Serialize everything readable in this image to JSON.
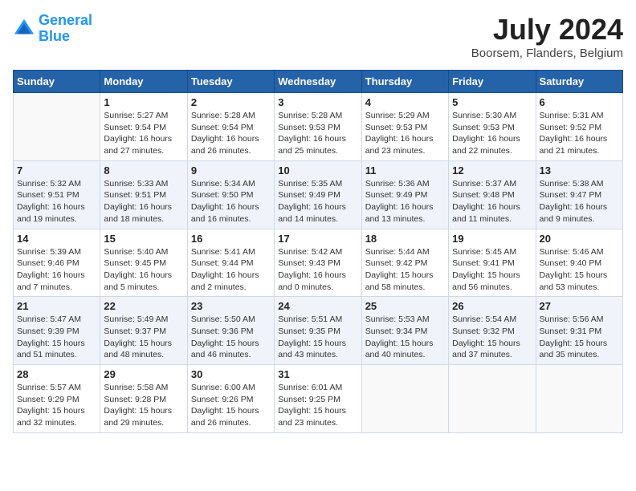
{
  "header": {
    "logo_line1": "General",
    "logo_line2": "Blue",
    "month_year": "July 2024",
    "location": "Boorsem, Flanders, Belgium"
  },
  "days_of_week": [
    "Sunday",
    "Monday",
    "Tuesday",
    "Wednesday",
    "Thursday",
    "Friday",
    "Saturday"
  ],
  "weeks": [
    [
      {
        "day": "",
        "content": ""
      },
      {
        "day": "1",
        "content": "Sunrise: 5:27 AM\nSunset: 9:54 PM\nDaylight: 16 hours and 27 minutes."
      },
      {
        "day": "2",
        "content": "Sunrise: 5:28 AM\nSunset: 9:54 PM\nDaylight: 16 hours and 26 minutes."
      },
      {
        "day": "3",
        "content": "Sunrise: 5:28 AM\nSunset: 9:53 PM\nDaylight: 16 hours and 25 minutes."
      },
      {
        "day": "4",
        "content": "Sunrise: 5:29 AM\nSunset: 9:53 PM\nDaylight: 16 hours and 23 minutes."
      },
      {
        "day": "5",
        "content": "Sunrise: 5:30 AM\nSunset: 9:53 PM\nDaylight: 16 hours and 22 minutes."
      },
      {
        "day": "6",
        "content": "Sunrise: 5:31 AM\nSunset: 9:52 PM\nDaylight: 16 hours and 21 minutes."
      }
    ],
    [
      {
        "day": "7",
        "content": "Sunrise: 5:32 AM\nSunset: 9:51 PM\nDaylight: 16 hours and 19 minutes."
      },
      {
        "day": "8",
        "content": "Sunrise: 5:33 AM\nSunset: 9:51 PM\nDaylight: 16 hours and 18 minutes."
      },
      {
        "day": "9",
        "content": "Sunrise: 5:34 AM\nSunset: 9:50 PM\nDaylight: 16 hours and 16 minutes."
      },
      {
        "day": "10",
        "content": "Sunrise: 5:35 AM\nSunset: 9:49 PM\nDaylight: 16 hours and 14 minutes."
      },
      {
        "day": "11",
        "content": "Sunrise: 5:36 AM\nSunset: 9:49 PM\nDaylight: 16 hours and 13 minutes."
      },
      {
        "day": "12",
        "content": "Sunrise: 5:37 AM\nSunset: 9:48 PM\nDaylight: 16 hours and 11 minutes."
      },
      {
        "day": "13",
        "content": "Sunrise: 5:38 AM\nSunset: 9:47 PM\nDaylight: 16 hours and 9 minutes."
      }
    ],
    [
      {
        "day": "14",
        "content": "Sunrise: 5:39 AM\nSunset: 9:46 PM\nDaylight: 16 hours and 7 minutes."
      },
      {
        "day": "15",
        "content": "Sunrise: 5:40 AM\nSunset: 9:45 PM\nDaylight: 16 hours and 5 minutes."
      },
      {
        "day": "16",
        "content": "Sunrise: 5:41 AM\nSunset: 9:44 PM\nDaylight: 16 hours and 2 minutes."
      },
      {
        "day": "17",
        "content": "Sunrise: 5:42 AM\nSunset: 9:43 PM\nDaylight: 16 hours and 0 minutes."
      },
      {
        "day": "18",
        "content": "Sunrise: 5:44 AM\nSunset: 9:42 PM\nDaylight: 15 hours and 58 minutes."
      },
      {
        "day": "19",
        "content": "Sunrise: 5:45 AM\nSunset: 9:41 PM\nDaylight: 15 hours and 56 minutes."
      },
      {
        "day": "20",
        "content": "Sunrise: 5:46 AM\nSunset: 9:40 PM\nDaylight: 15 hours and 53 minutes."
      }
    ],
    [
      {
        "day": "21",
        "content": "Sunrise: 5:47 AM\nSunset: 9:39 PM\nDaylight: 15 hours and 51 minutes."
      },
      {
        "day": "22",
        "content": "Sunrise: 5:49 AM\nSunset: 9:37 PM\nDaylight: 15 hours and 48 minutes."
      },
      {
        "day": "23",
        "content": "Sunrise: 5:50 AM\nSunset: 9:36 PM\nDaylight: 15 hours and 46 minutes."
      },
      {
        "day": "24",
        "content": "Sunrise: 5:51 AM\nSunset: 9:35 PM\nDaylight: 15 hours and 43 minutes."
      },
      {
        "day": "25",
        "content": "Sunrise: 5:53 AM\nSunset: 9:34 PM\nDaylight: 15 hours and 40 minutes."
      },
      {
        "day": "26",
        "content": "Sunrise: 5:54 AM\nSunset: 9:32 PM\nDaylight: 15 hours and 37 minutes."
      },
      {
        "day": "27",
        "content": "Sunrise: 5:56 AM\nSunset: 9:31 PM\nDaylight: 15 hours and 35 minutes."
      }
    ],
    [
      {
        "day": "28",
        "content": "Sunrise: 5:57 AM\nSunset: 9:29 PM\nDaylight: 15 hours and 32 minutes."
      },
      {
        "day": "29",
        "content": "Sunrise: 5:58 AM\nSunset: 9:28 PM\nDaylight: 15 hours and 29 minutes."
      },
      {
        "day": "30",
        "content": "Sunrise: 6:00 AM\nSunset: 9:26 PM\nDaylight: 15 hours and 26 minutes."
      },
      {
        "day": "31",
        "content": "Sunrise: 6:01 AM\nSunset: 9:25 PM\nDaylight: 15 hours and 23 minutes."
      },
      {
        "day": "",
        "content": ""
      },
      {
        "day": "",
        "content": ""
      },
      {
        "day": "",
        "content": ""
      }
    ]
  ]
}
